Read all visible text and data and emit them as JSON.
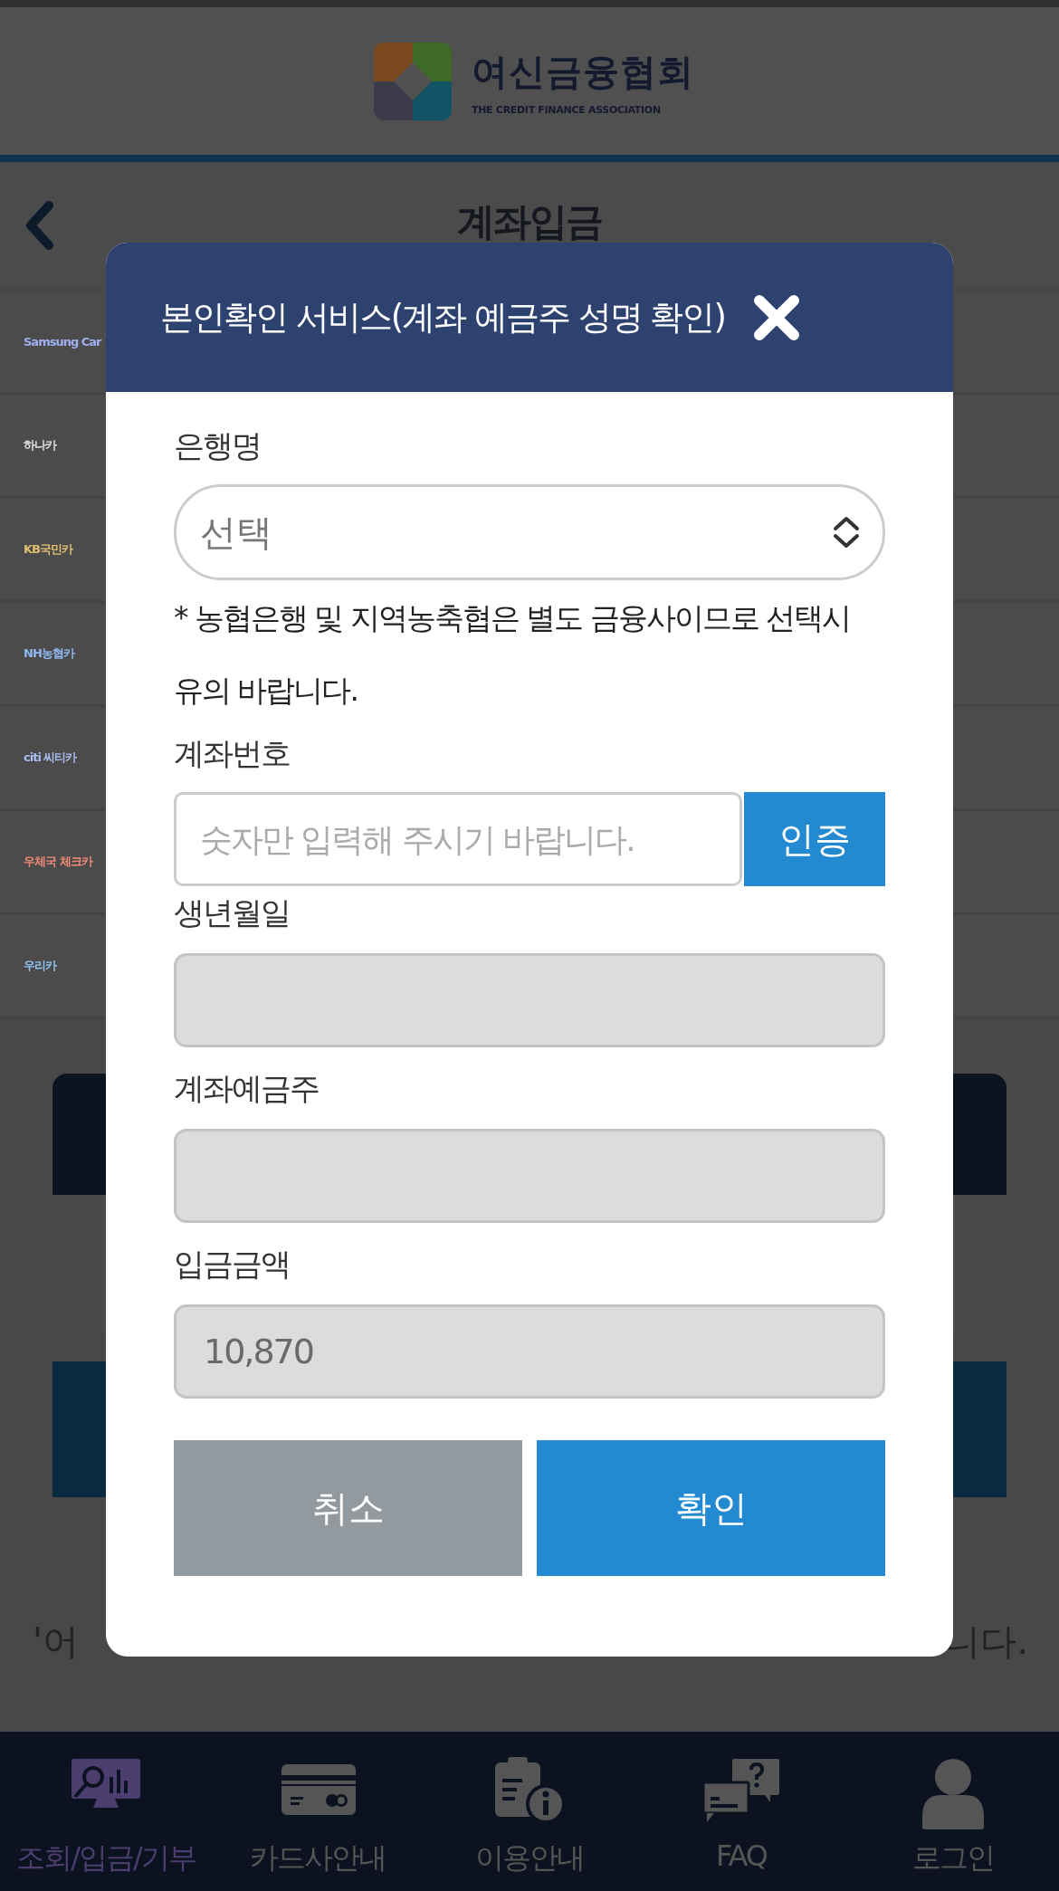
{
  "header": {
    "logo_name": "여신금융협회",
    "logo_subtitle": "THE CREDIT FINANCE ASSOCIATION"
  },
  "page_title": "계좌입금",
  "card_list": [
    {
      "name": "Samsung Car",
      "color": "#9fb0f0"
    },
    {
      "name": "하나카",
      "color": "#e0e0e0"
    },
    {
      "name": "KB국민카",
      "color": "#e0c070"
    },
    {
      "name": "NH농협카",
      "color": "#90b8f0"
    },
    {
      "name": "citi 씨티카",
      "color": "#a8bcf0"
    },
    {
      "name": "우체국 체크카",
      "color": "#f08a78"
    },
    {
      "name": "우리카",
      "color": "#90c4f0"
    }
  ],
  "notice_fragments": [
    "'어",
    "니다."
  ],
  "modal": {
    "title": "본인확인 서비스(계좌 예금주 성명 확인)",
    "fields": [
      {
        "kind": "select",
        "label": "은행명",
        "value": "선택"
      },
      {
        "kind": "note",
        "text": "* 농협은행 및 지역농축협은 별도 금융사이므로 선택시 유의 바랍니다."
      },
      {
        "kind": "input",
        "label": "계좌번호",
        "placeholder": "숫자만 입력해 주시기 바랍니다.",
        "button": "인증"
      },
      {
        "kind": "readonly",
        "label": "생년월일"
      },
      {
        "kind": "readonly",
        "label": "계좌예금주"
      },
      {
        "kind": "readonly",
        "label": "입금금액",
        "value": "10,870"
      }
    ],
    "buttons": [
      {
        "kind": "cancel",
        "label": "취소"
      },
      {
        "kind": "confirm",
        "label": "확인"
      }
    ]
  },
  "nav": [
    {
      "kind": "search",
      "label": "조회/입금/기부",
      "selected": true
    },
    {
      "kind": "card",
      "label": "카드사안내",
      "selected": false
    },
    {
      "kind": "info",
      "label": "이용안내",
      "selected": false
    },
    {
      "kind": "faq",
      "label": "FAQ",
      "selected": false
    },
    {
      "kind": "user",
      "label": "로그인",
      "selected": false
    }
  ]
}
